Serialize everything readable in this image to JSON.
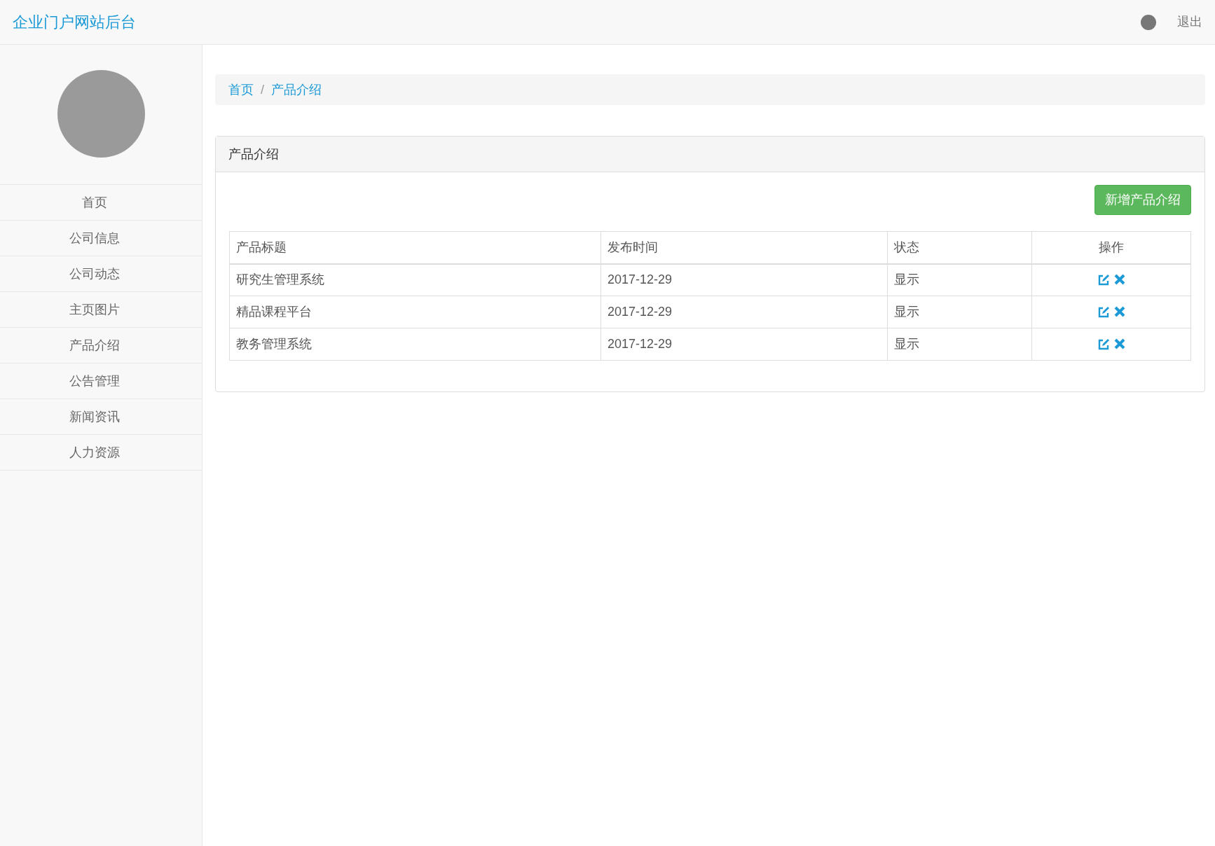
{
  "header": {
    "title": "企业门户网站后台",
    "logout": "退出"
  },
  "sidebar": {
    "items": [
      {
        "label": "首页"
      },
      {
        "label": "公司信息"
      },
      {
        "label": "公司动态"
      },
      {
        "label": "主页图片"
      },
      {
        "label": "产品介绍"
      },
      {
        "label": "公告管理"
      },
      {
        "label": "新闻资讯"
      },
      {
        "label": "人力资源"
      }
    ]
  },
  "breadcrumb": {
    "separator": "/",
    "items": [
      "首页",
      "产品介绍"
    ]
  },
  "panel": {
    "title": "产品介绍",
    "add_button": "新增产品介绍",
    "table": {
      "columns": [
        "产品标题",
        "发布时间",
        "状态",
        "操作"
      ],
      "rows": [
        {
          "title": "研究生管理系统",
          "date": "2017-12-29",
          "status": "显示"
        },
        {
          "title": "精品课程平台",
          "date": "2017-12-29",
          "status": "显示"
        },
        {
          "title": "教务管理系统",
          "date": "2017-12-29",
          "status": "显示"
        }
      ]
    }
  }
}
